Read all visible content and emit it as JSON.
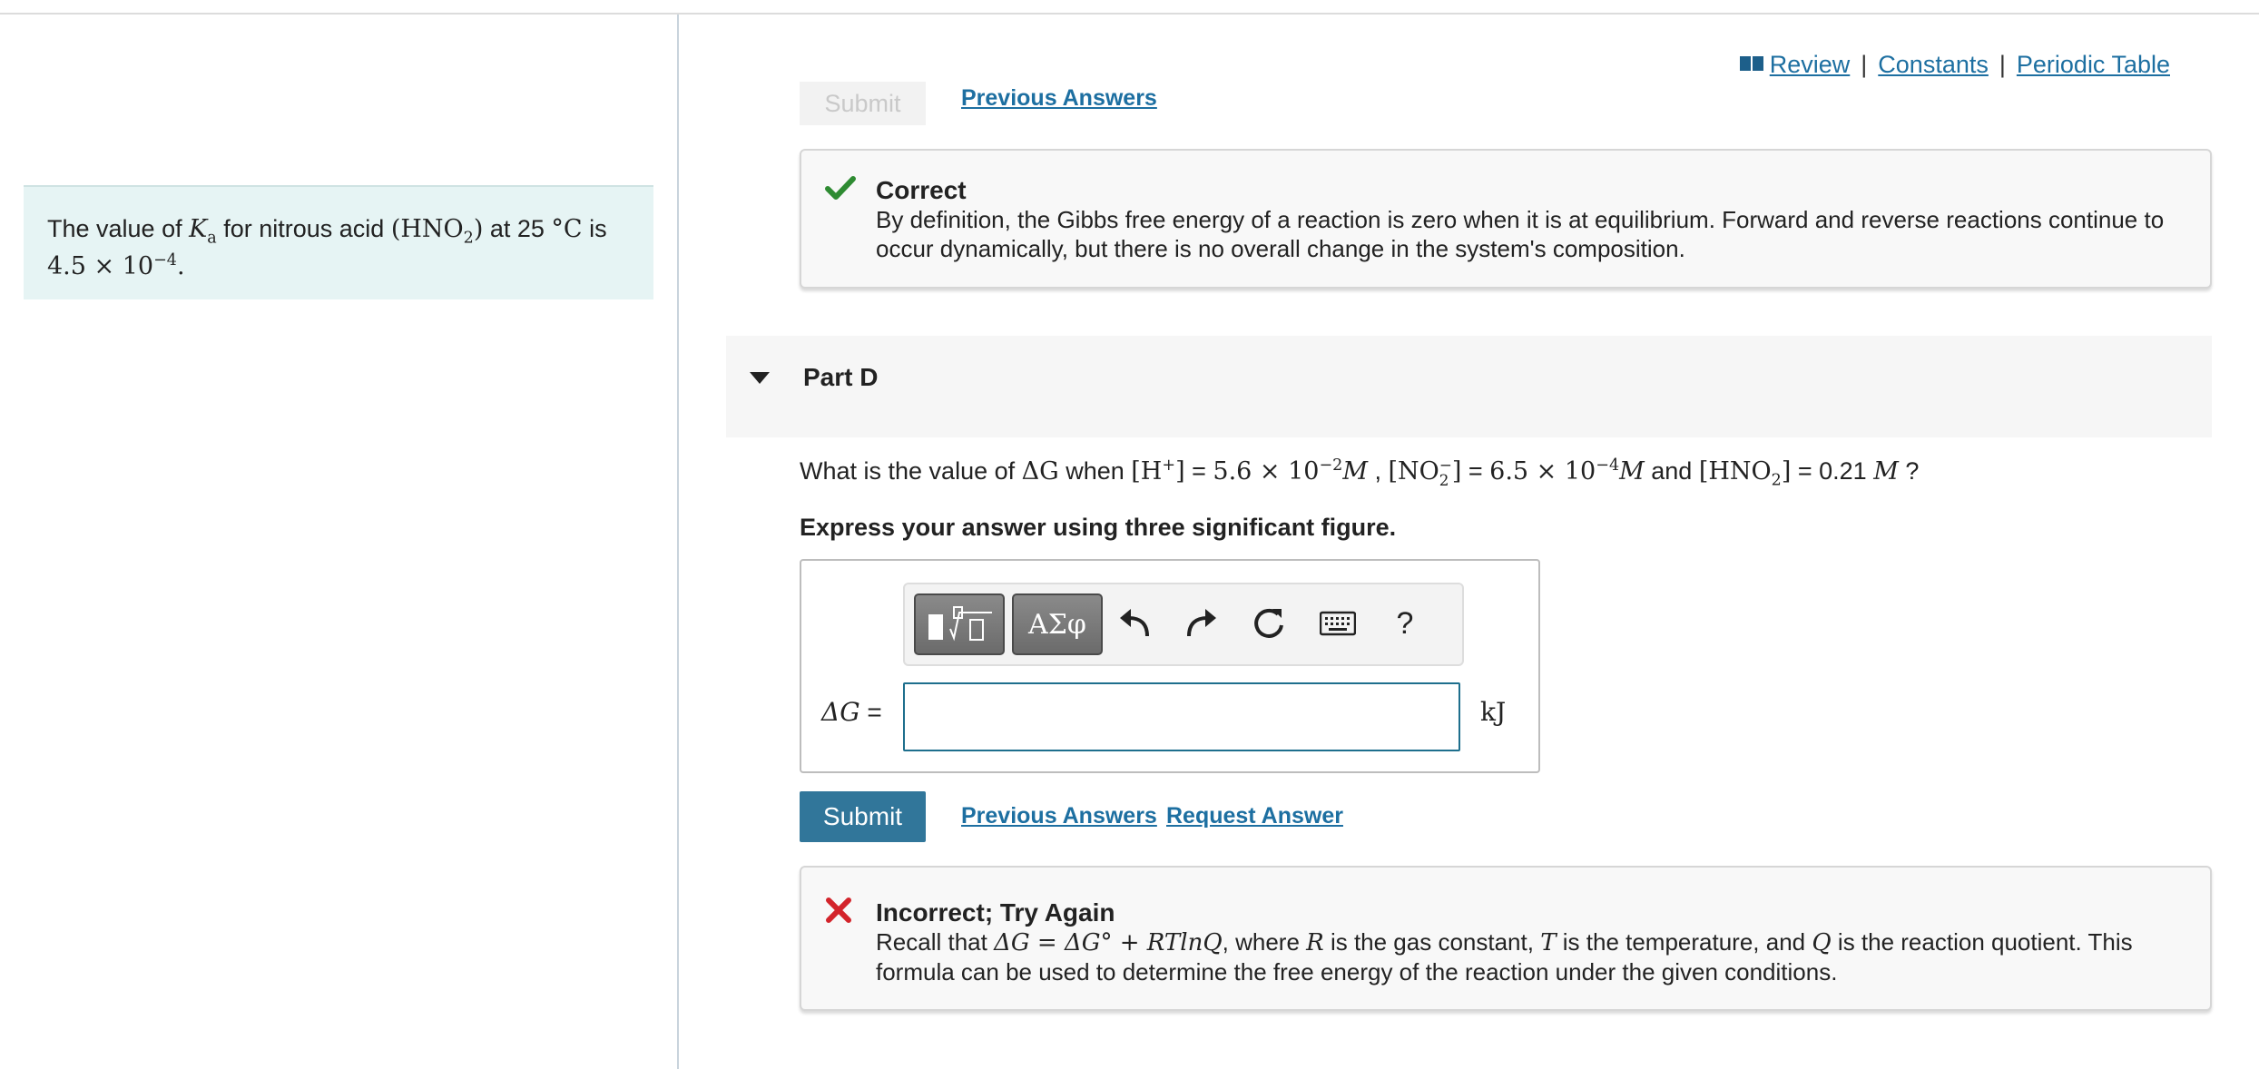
{
  "colors": {
    "accent": "#31769a",
    "link": "#1d6fa1",
    "correct": "#2e8b32",
    "incorrect": "#d3242b",
    "info_bg": "#e6f4f4"
  },
  "left_panel": {
    "t1": "The value of ",
    "ka_K": "K",
    "ka_sub": "a",
    "t2": " for nitrous acid ",
    "formula": "(HNO",
    "formula_sub": "2",
    "formula_close": ")",
    "t3": " at 25 ",
    "temp_unit": "°C",
    "t4": " is",
    "value_mant": "4.5 × 10",
    "value_exp": "−4",
    "value_end": "."
  },
  "top_links": {
    "review": "Review",
    "sep1": "|",
    "constants": "Constants",
    "sep2": "|",
    "periodic": "Periodic Table",
    "book_icon": "book-icon"
  },
  "prev_section": {
    "submit_label": "Submit",
    "previous_answers": "Previous Answers"
  },
  "feedback_correct": {
    "icon": "check-icon",
    "title": "Correct",
    "text": "By definition, the Gibbs free energy of a reaction is zero when it is at equilibrium. Forward and reverse reactions continue to occur dynamically, but there is no overall change in the system's composition."
  },
  "part": {
    "title": "Part D"
  },
  "question": {
    "q1": "What is the value of ",
    "dG": "ΔG",
    "q2": " when ",
    "h_open": "[H",
    "h_sup": "+",
    "h_close": "]",
    "eq1": " = ",
    "h_val": "5.6 × 10",
    "h_exp": "−2",
    "M1": "M",
    "comma": " , ",
    "no2_open": "[NO",
    "no2_sub": "2",
    "no2_sup": "−",
    "no2_close": "]",
    "eq2": " = ",
    "no2_val": "6.5 × 10",
    "no2_exp": "−4",
    "M2": "M",
    "and": " and ",
    "hno2_open": "[HNO",
    "hno2_sub": "2",
    "hno2_close": "]",
    "eq3": " = 0.21 ",
    "M3": "M",
    "qmark": " ?"
  },
  "instruction": "Express your answer using three significant figure.",
  "answer": {
    "label_sym": "ΔG",
    "label_eq": " =",
    "value": "",
    "placeholder": "",
    "unit": "kJ",
    "toolbar": {
      "templates_icon": "templates-icon",
      "greek_label": "ΑΣφ",
      "undo_icon": "undo-icon",
      "redo_icon": "redo-icon",
      "reset_icon": "reset-icon",
      "keyboard_icon": "keyboard-icon",
      "help_label": "?"
    }
  },
  "actions": {
    "submit_label": "Submit",
    "previous_answers": "Previous Answers",
    "request_answer": "Request Answer"
  },
  "feedback_incorrect": {
    "icon": "x-icon",
    "title": "Incorrect; Try Again",
    "t1": "Recall that ",
    "formula": "ΔG = ΔG° + RTlnQ",
    "t2": ", where ",
    "R": "R",
    "t3": " is the gas constant, ",
    "T": "T",
    "t4": " is the temperature, and ",
    "Q": "Q",
    "t5": " is the reaction quotient. This formula can be used to determine the free energy of the reaction under the given conditions."
  }
}
